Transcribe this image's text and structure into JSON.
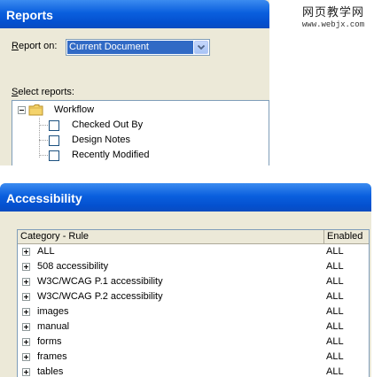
{
  "reports_window": {
    "title": "Reports",
    "report_on_label_u": "R",
    "report_on_label_rest": "eport on:",
    "report_on_value": "Current Document",
    "select_reports_label_u": "S",
    "select_reports_label_rest": "elect reports:",
    "tree": {
      "folder": "Workflow",
      "items": [
        {
          "label": "Checked Out By",
          "checked": false
        },
        {
          "label": "Design Notes",
          "checked": false
        },
        {
          "label": "Recently Modified",
          "checked": false
        }
      ]
    }
  },
  "watermark": {
    "title": "网页教学网",
    "url": "www.webjx.com"
  },
  "accessibility_window": {
    "title": "Accessibility",
    "columns": [
      "Category - Rule",
      "Enabled"
    ],
    "rows": [
      {
        "rule": "ALL",
        "enabled": "ALL"
      },
      {
        "rule": "508 accessibility",
        "enabled": "ALL"
      },
      {
        "rule": "W3C/WCAG P.1 accessibility",
        "enabled": "ALL"
      },
      {
        "rule": "W3C/WCAG P.2 accessibility",
        "enabled": "ALL"
      },
      {
        "rule": "images",
        "enabled": "ALL"
      },
      {
        "rule": "manual",
        "enabled": "ALL"
      },
      {
        "rule": "forms",
        "enabled": "ALL"
      },
      {
        "rule": "frames",
        "enabled": "ALL"
      },
      {
        "rule": "tables",
        "enabled": "ALL"
      }
    ]
  },
  "colors": {
    "titlebar": "#0a5fde",
    "selection": "#316ac5",
    "dialog_bg": "#ece9d8",
    "border": "#7f9db9"
  }
}
